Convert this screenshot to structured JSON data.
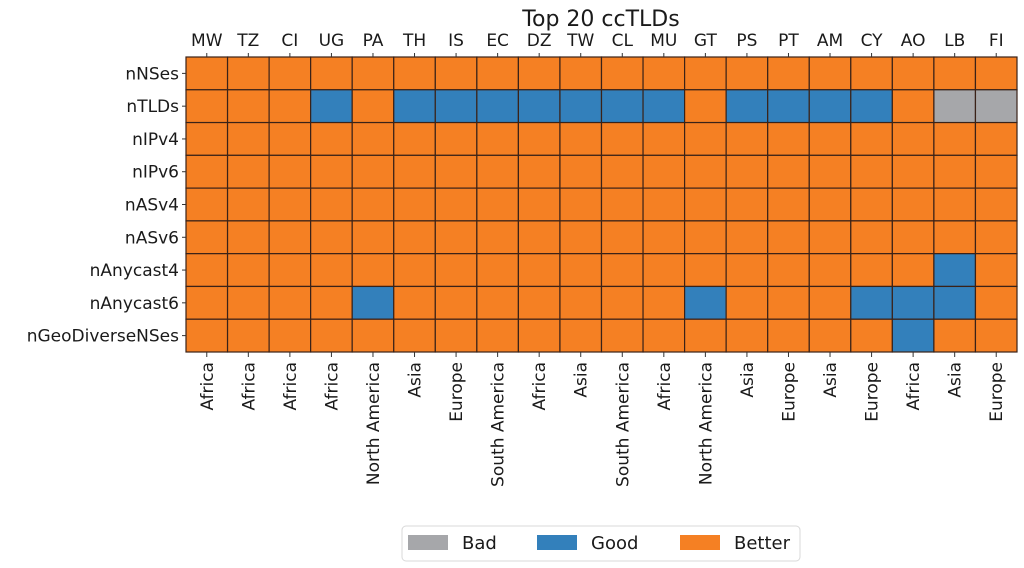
{
  "chart_data": {
    "type": "heatmap",
    "title": "Top 20 ccTLDs",
    "columns": [
      "MW",
      "TZ",
      "CI",
      "UG",
      "PA",
      "TH",
      "IS",
      "EC",
      "DZ",
      "TW",
      "CL",
      "MU",
      "GT",
      "PS",
      "PT",
      "AM",
      "CY",
      "AO",
      "LB",
      "FI"
    ],
    "column_regions": [
      "Africa",
      "Africa",
      "Africa",
      "Africa",
      "North America",
      "Asia",
      "Europe",
      "South America",
      "Africa",
      "Asia",
      "South America",
      "Africa",
      "North America",
      "Asia",
      "Europe",
      "Asia",
      "Europe",
      "Africa",
      "Asia",
      "Europe"
    ],
    "rows": [
      "nNSes",
      "nTLDs",
      "nIPv4",
      "nIPv6",
      "nASv4",
      "nASv6",
      "nAnycast4",
      "nAnycast6",
      "nGeoDiverseNSes"
    ],
    "categories": [
      "Bad",
      "Good",
      "Better"
    ],
    "colors": {
      "Bad": "#a6a7aa",
      "Good": "#3380bb",
      "Better": "#f58023"
    },
    "values": [
      [
        "Better",
        "Better",
        "Better",
        "Better",
        "Better",
        "Better",
        "Better",
        "Better",
        "Better",
        "Better",
        "Better",
        "Better",
        "Better",
        "Better",
        "Better",
        "Better",
        "Better",
        "Better",
        "Better",
        "Better"
      ],
      [
        "Better",
        "Better",
        "Better",
        "Good",
        "Better",
        "Good",
        "Good",
        "Good",
        "Good",
        "Good",
        "Good",
        "Good",
        "Better",
        "Good",
        "Good",
        "Good",
        "Good",
        "Better",
        "Bad",
        "Bad"
      ],
      [
        "Better",
        "Better",
        "Better",
        "Better",
        "Better",
        "Better",
        "Better",
        "Better",
        "Better",
        "Better",
        "Better",
        "Better",
        "Better",
        "Better",
        "Better",
        "Better",
        "Better",
        "Better",
        "Better",
        "Better"
      ],
      [
        "Better",
        "Better",
        "Better",
        "Better",
        "Better",
        "Better",
        "Better",
        "Better",
        "Better",
        "Better",
        "Better",
        "Better",
        "Better",
        "Better",
        "Better",
        "Better",
        "Better",
        "Better",
        "Better",
        "Better"
      ],
      [
        "Better",
        "Better",
        "Better",
        "Better",
        "Better",
        "Better",
        "Better",
        "Better",
        "Better",
        "Better",
        "Better",
        "Better",
        "Better",
        "Better",
        "Better",
        "Better",
        "Better",
        "Better",
        "Better",
        "Better"
      ],
      [
        "Better",
        "Better",
        "Better",
        "Better",
        "Better",
        "Better",
        "Better",
        "Better",
        "Better",
        "Better",
        "Better",
        "Better",
        "Better",
        "Better",
        "Better",
        "Better",
        "Better",
        "Better",
        "Better",
        "Better"
      ],
      [
        "Better",
        "Better",
        "Better",
        "Better",
        "Better",
        "Better",
        "Better",
        "Better",
        "Better",
        "Better",
        "Better",
        "Better",
        "Better",
        "Better",
        "Better",
        "Better",
        "Better",
        "Better",
        "Good",
        "Better"
      ],
      [
        "Better",
        "Better",
        "Better",
        "Better",
        "Good",
        "Better",
        "Better",
        "Better",
        "Better",
        "Better",
        "Better",
        "Better",
        "Good",
        "Better",
        "Better",
        "Better",
        "Good",
        "Good",
        "Good",
        "Better"
      ],
      [
        "Better",
        "Better",
        "Better",
        "Better",
        "Better",
        "Better",
        "Better",
        "Better",
        "Better",
        "Better",
        "Better",
        "Better",
        "Better",
        "Better",
        "Better",
        "Better",
        "Better",
        "Good",
        "Better",
        "Better"
      ]
    ],
    "legend": {
      "entries": [
        "Bad",
        "Good",
        "Better"
      ],
      "placement": "bottom-center"
    },
    "grid": true
  }
}
